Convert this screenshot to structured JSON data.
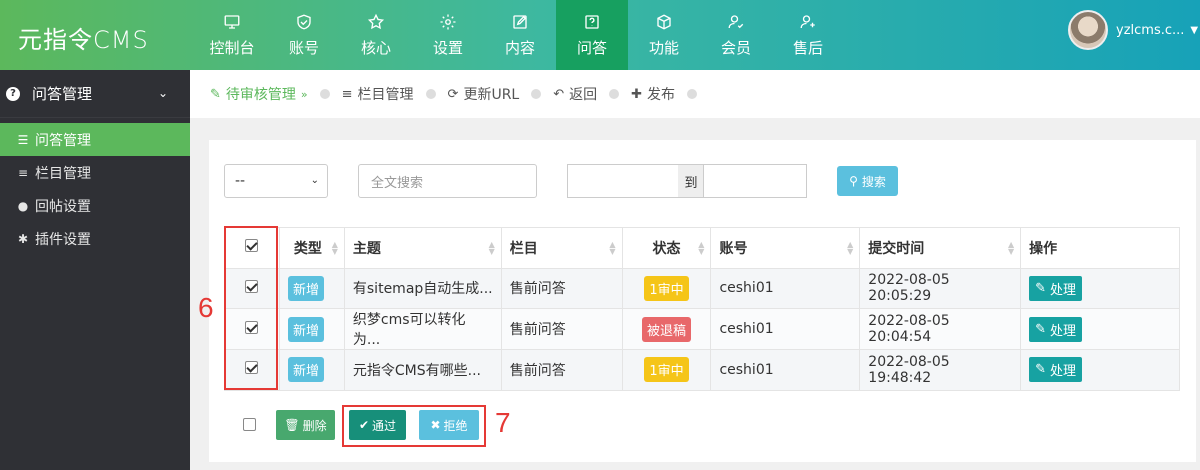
{
  "app": {
    "logo": "元指令CMS"
  },
  "nav": [
    {
      "label": "控制台",
      "icon": "monitor-icon"
    },
    {
      "label": "账号",
      "icon": "shield-icon"
    },
    {
      "label": "核心",
      "icon": "star-icon"
    },
    {
      "label": "设置",
      "icon": "gear-icon"
    },
    {
      "label": "内容",
      "icon": "edit-icon"
    },
    {
      "label": "问答",
      "icon": "question-icon",
      "active": true
    },
    {
      "label": "功能",
      "icon": "cube-icon"
    },
    {
      "label": "会员",
      "icon": "user-check-icon"
    },
    {
      "label": "售后",
      "icon": "user-plus-icon"
    }
  ],
  "user": {
    "name": "yzlcms.c..."
  },
  "sidebar": {
    "header": "问答管理",
    "items": [
      {
        "label": "问答管理",
        "icon": "list-icon",
        "active": true
      },
      {
        "label": "栏目管理",
        "icon": "bars-icon"
      },
      {
        "label": "回帖设置",
        "icon": "comments-icon"
      },
      {
        "label": "插件设置",
        "icon": "cog-icon"
      }
    ]
  },
  "toolbar": {
    "pending": "待审核管理",
    "category": "栏目管理",
    "update_url": "更新URL",
    "back": "返回",
    "publish": "发布"
  },
  "filter": {
    "select_value": "--",
    "search_placeholder": "全文搜索",
    "date_to": "到",
    "search_button": "搜索"
  },
  "table": {
    "headers": [
      "类型",
      "主题",
      "栏目",
      "状态",
      "账号",
      "提交时间",
      "操作"
    ],
    "rows": [
      {
        "checked": true,
        "type": "新增",
        "title": "有sitemap自动生成...",
        "category": "售前问答",
        "status": "1审中",
        "status_color": "#f5c518",
        "account": "ceshi01",
        "time": "2022-08-05 20:05:29",
        "action": "处理"
      },
      {
        "checked": true,
        "type": "新增",
        "title": "织梦cms可以转化为...",
        "category": "售前问答",
        "status": "被退稿",
        "status_color": "#e8686a",
        "account": "ceshi01",
        "time": "2022-08-05 20:04:54",
        "action": "处理"
      },
      {
        "checked": true,
        "type": "新增",
        "title": "元指令CMS有哪些...",
        "category": "售前问答",
        "status": "1审中",
        "status_color": "#f5c518",
        "account": "ceshi01",
        "time": "2022-08-05 19:48:42",
        "action": "处理"
      }
    ]
  },
  "actions": {
    "delete": "删除",
    "pass": "通过",
    "reject": "拒绝"
  },
  "annotations": {
    "a6": "6",
    "a7": "7"
  }
}
